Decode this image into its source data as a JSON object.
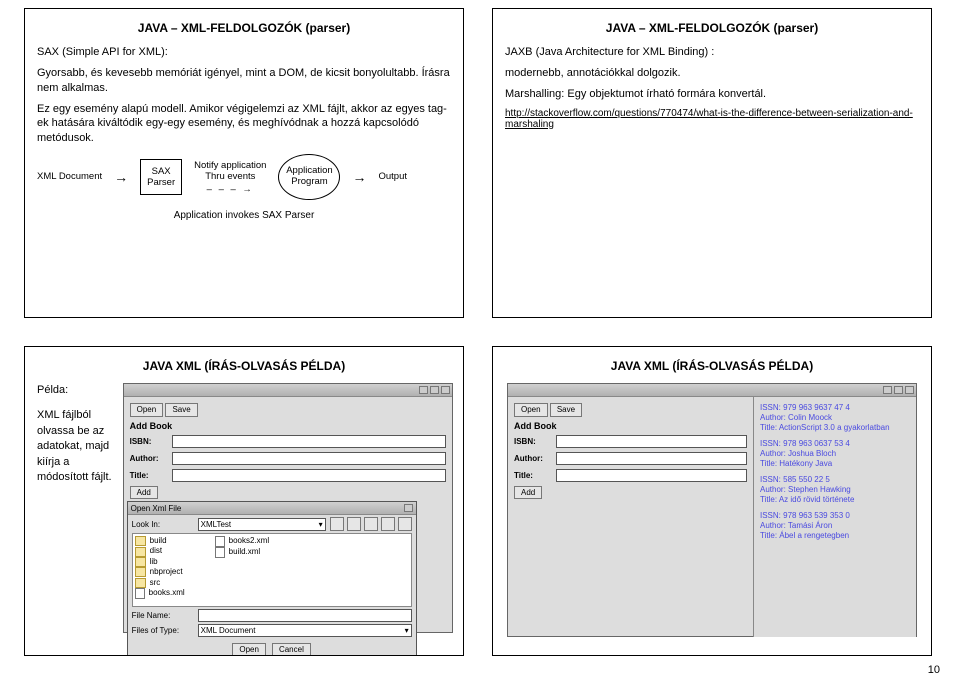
{
  "page_number": "10",
  "slide1": {
    "title": "JAVA – XML-FELDOLGOZÓK (parser)",
    "p1": "SAX (Simple API for XML):",
    "p2": "Gyorsabb, és kevesebb memóriát igényel, mint a DOM, de kicsit bonyolultabb. Írásra nem alkalmas.",
    "p3": "Ez egy esemény alapú modell. Amikor végigelemzi az XML fájlt, akkor az egyes tag-ek hatására kiváltódik egy-egy esemény, és meghívódnak a hozzá kapcsolódó metódusok.",
    "diag": {
      "xml_doc": "XML\nDocument",
      "sax_parser": "SAX\nParser",
      "notify": "Notify application\nThru events",
      "app_prog": "Application\nProgram",
      "output": "Output",
      "caption": "Application invokes SAX Parser"
    }
  },
  "slide2": {
    "title": "JAVA – XML-FELDOLGOZÓK (parser)",
    "p1": "JAXB (Java Architecture for XML Binding) :",
    "p2": "modernebb, annotációkkal dolgozik.",
    "p3": "Marshalling: Egy objektumot írható formára konvertál.",
    "link": "http://stackoverflow.com/questions/770474/what-is-the-difference-between-serialization-and-marshaling"
  },
  "slide3": {
    "title": "JAVA XML (ÍRÁS-OLVASÁS PÉLDA)",
    "side_label": "Példa:",
    "side_text": "XML fájlból olvassa be az adatokat, majd kiírja a módosított fájlt.",
    "app": {
      "open": "Open",
      "save": "Save",
      "add_book": "Add Book",
      "isbn": "ISBN:",
      "author": "Author:",
      "title": "Title:",
      "add": "Add"
    },
    "dialog": {
      "title": "Open Xml File",
      "look_in_lbl": "Look In:",
      "look_in_val": "XMLTest",
      "items": [
        "build",
        "dist",
        "lib",
        "nbproject",
        "src",
        "books.xml",
        "books2.xml",
        "build.xml"
      ],
      "file_name_lbl": "File Name:",
      "file_type_lbl": "Files of Type:",
      "file_type_val": "XML Document",
      "open_btn": "Open",
      "cancel_btn": "Cancel"
    }
  },
  "slide4": {
    "title": "JAVA XML (ÍRÁS-OLVASÁS PÉLDA)",
    "app": {
      "open": "Open",
      "save": "Save",
      "add_book": "Add Book",
      "isbn": "ISBN:",
      "author": "Author:",
      "title": "Title:",
      "add": "Add"
    },
    "books": [
      {
        "isbn": "ISSN: 979 963 9637 47 4",
        "author": "Author: Colin Moock",
        "title": "Title: ActionScript 3.0 a gyakorlatban"
      },
      {
        "isbn": "ISSN: 978 963 0637 53 4",
        "author": "Author: Joshua Bloch",
        "title": "Title: Hatékony Java"
      },
      {
        "isbn": "ISSN: 585 550 22 5",
        "author": "Author: Stephen Hawking",
        "title": "Title: Az idő rövid története"
      },
      {
        "isbn": "ISSN: 978 963 539 353 0",
        "author": "Author: Tamási Áron",
        "title": "Title: Ábel a rengetegben"
      }
    ]
  }
}
